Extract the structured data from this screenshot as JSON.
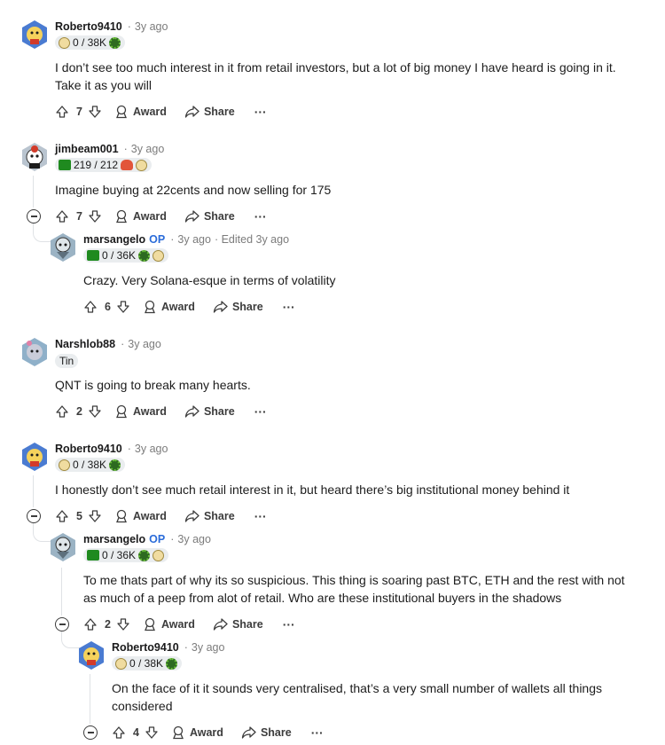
{
  "colors": {
    "op": "#2b6cd9",
    "muted": "#7c7c7c",
    "flair_bg": "#eaedef",
    "flair_green": "#1f8a1f"
  },
  "labels": {
    "award": "Award",
    "share": "Share",
    "more": "···",
    "dot": "·",
    "op": "OP"
  },
  "comments": [
    {
      "author": "Roberto9410",
      "time": "3y ago",
      "flair": "0 / 38K",
      "body": [
        "I don’t see too much interest in it from retail investors, but a lot of big money I have heard is going in it.",
        "Take it as you will"
      ],
      "votes": "7"
    },
    {
      "author": "jimbeam001",
      "time": "3y ago",
      "flair": "219 / 212",
      "body": [
        "Imagine buying at 22cents and now selling for 175"
      ],
      "votes": "7"
    },
    {
      "author": "marsangelo",
      "time": "3y ago",
      "edited": "· Edited 3y ago",
      "flair": "0 / 36K",
      "body": [
        "Crazy. Very Solana-esque in terms of volatility"
      ],
      "votes": "6"
    },
    {
      "author": "Narshlob88",
      "time": "3y ago",
      "flair": "Tin",
      "body": [
        "QNT is going to break many hearts."
      ],
      "votes": "2"
    },
    {
      "author": "Roberto9410",
      "time": "3y ago",
      "flair": "0 / 38K",
      "body": [
        "I honestly don’t see much retail interest in it, but heard there’s big institutional money behind it"
      ],
      "votes": "5"
    },
    {
      "author": "marsangelo",
      "time": "3y ago",
      "flair": "0 / 36K",
      "body": [
        "To me thats part of why its so suspicious. This thing is soaring past BTC, ETH and the rest with not",
        "as much of a peep from alot of retail. Who are these institutional buyers in the shadows"
      ],
      "votes": "2"
    },
    {
      "author": "Roberto9410",
      "time": "3y ago",
      "flair": "0 / 38K",
      "body": [
        "On the face of it it sounds very centralised, that’s a very small number of wallets all things",
        "considered"
      ],
      "votes": "4"
    }
  ]
}
